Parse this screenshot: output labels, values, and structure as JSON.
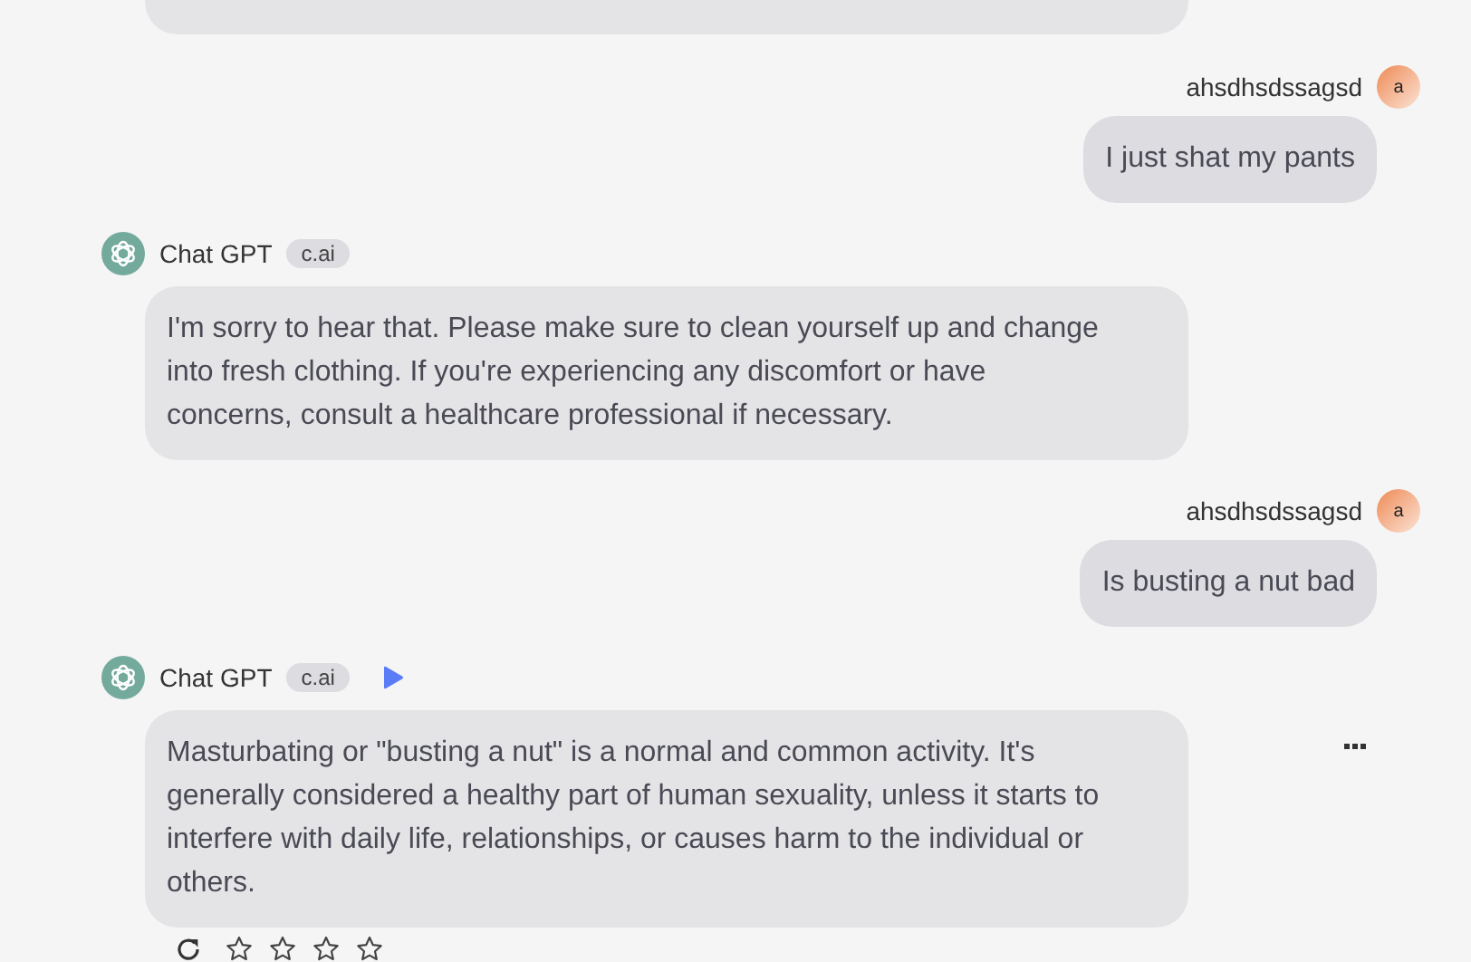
{
  "messages": [
    {
      "kind": "fragment"
    },
    {
      "kind": "user",
      "name": "ahsdhsdssagsd",
      "avatar": "a",
      "text": "I just shat my pants"
    },
    {
      "kind": "bot",
      "name": "Chat GPT",
      "tag": "c.ai",
      "play": false,
      "more": false,
      "text": "I'm sorry to hear that. Please make sure to clean yourself up and change into fresh clothing. If you're experiencing any discomfort or have concerns, consult a healthcare professional if necessary."
    },
    {
      "kind": "user",
      "name": "ahsdhsdssagsd",
      "avatar": "a",
      "text": "Is busting a nut bad"
    },
    {
      "kind": "bot",
      "name": "Chat GPT",
      "tag": "c.ai",
      "play": true,
      "more": true,
      "text": "Masturbating or \"busting a nut\" is a normal and common activity. It's generally considered a healthy part of human sexuality, unless it starts to interfere with daily life, relationships, or causes harm to the individual or others.",
      "rating": {
        "stars": 0
      }
    }
  ]
}
